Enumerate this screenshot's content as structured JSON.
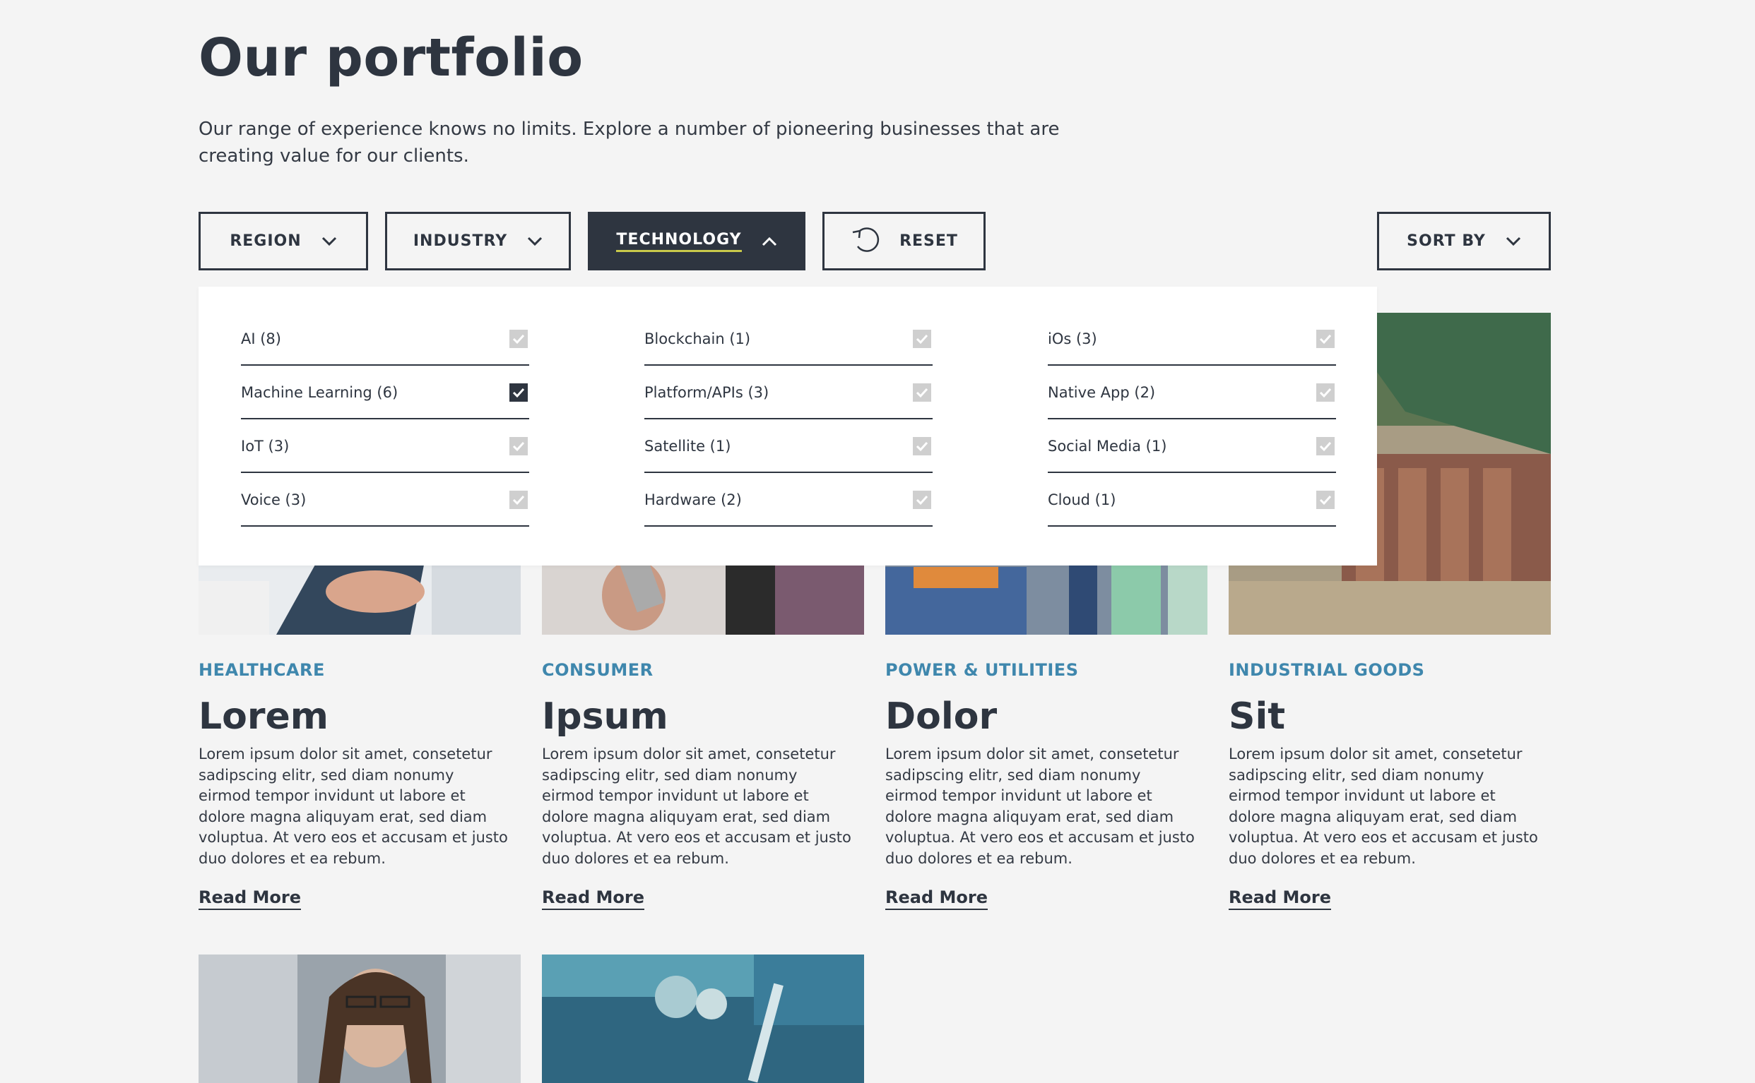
{
  "header": {
    "title": "Our portfolio",
    "intro": "Our range of experience knows no limits. Explore a number of pioneering businesses that are creating value for our clients."
  },
  "filters": {
    "region": "REGION",
    "industry": "INDUSTRY",
    "technology": "TECHNOLOGY",
    "reset": "RESET",
    "sort": "SORT BY"
  },
  "technology_options": {
    "col1": [
      {
        "label": "AI (8)",
        "checked": false
      },
      {
        "label": "Machine Learning (6)",
        "checked": true
      },
      {
        "label": "IoT (3)",
        "checked": false
      },
      {
        "label": "Voice (3)",
        "checked": false
      }
    ],
    "col2": [
      {
        "label": "Blockchain (1)",
        "checked": false
      },
      {
        "label": "Platform/APIs (3)",
        "checked": false
      },
      {
        "label": "Satellite (1)",
        "checked": false
      },
      {
        "label": "Hardware (2)",
        "checked": false
      }
    ],
    "col3": [
      {
        "label": "iOs (3)",
        "checked": false
      },
      {
        "label": "Native App (2)",
        "checked": false
      },
      {
        "label": "Social Media (1)",
        "checked": false
      },
      {
        "label": "Cloud (1)",
        "checked": false
      }
    ]
  },
  "cards": [
    {
      "category": "HEALTHCARE",
      "title": "Lorem",
      "text": "Lorem ipsum dolor sit amet, consetetur sadipscing elitr, sed diam nonumy eirmod tempor invidunt ut labore et dolore magna aliquyam erat, sed diam voluptua. At vero eos et accusam et justo duo dolores et ea rebum.",
      "link": "Read More"
    },
    {
      "category": "CONSUMER",
      "title": "Ipsum",
      "text": "Lorem ipsum dolor sit amet, consetetur sadipscing elitr, sed diam nonumy eirmod tempor invidunt ut labore et dolore magna aliquyam erat, sed diam voluptua. At vero eos et accusam et justo duo dolores et ea rebum.",
      "link": "Read More"
    },
    {
      "category": "POWER & UTILITIES",
      "title": "Dolor",
      "text": "Lorem ipsum dolor sit amet, consetetur sadipscing elitr, sed diam nonumy eirmod tempor invidunt ut labore et dolore magna aliquyam erat, sed diam voluptua. At vero eos et accusam et justo duo dolores et ea rebum.",
      "link": "Read More"
    },
    {
      "category": "INDUSTRIAL GOODS",
      "title": "Sit",
      "text": "Lorem ipsum dolor sit amet, consetetur sadipscing elitr, sed diam nonumy eirmod tempor invidunt ut labore et dolore magna aliquyam erat, sed diam voluptua. At vero eos et accusam et justo duo dolores et ea rebum.",
      "link": "Read More"
    }
  ],
  "icons": {
    "chevron": "chevron-down-icon",
    "chevron_up": "chevron-up-icon",
    "reset": "refresh-icon",
    "check": "checkmark-icon"
  },
  "colors": {
    "primary": "#2e3540",
    "accent_category": "#3f87ad",
    "underline_accent": "#c9c94a",
    "checkbox_unchecked": "#cfcfcf",
    "background": "#f4f4f4"
  }
}
